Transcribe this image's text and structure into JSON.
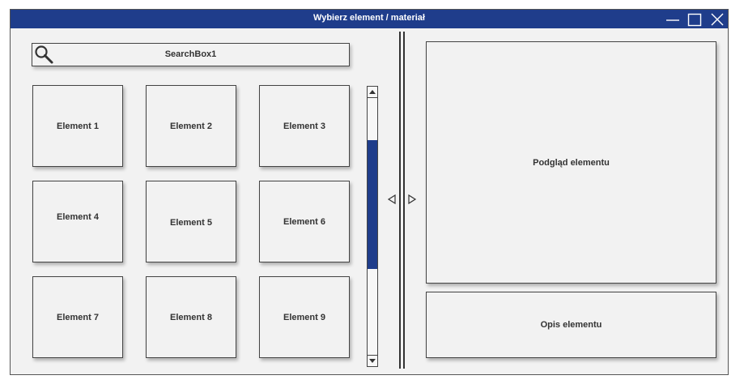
{
  "window": {
    "title": "Wybierz element / materiał"
  },
  "search": {
    "value": "SearchBox1"
  },
  "grid": {
    "items": [
      {
        "label": "Element 1"
      },
      {
        "label": "Element 2"
      },
      {
        "label": "Element 3"
      },
      {
        "label": "Element 4"
      },
      {
        "label": "Element 5"
      },
      {
        "label": "Element 6"
      },
      {
        "label": "Element 7"
      },
      {
        "label": "Element 8"
      },
      {
        "label": "Element 9"
      }
    ]
  },
  "scrollbar": {
    "position": 0.33,
    "visible_fraction": 0.5
  },
  "preview": {
    "label": "Podgląd elementu"
  },
  "description": {
    "label": "Opis elementu"
  },
  "icons": {
    "search": "search-icon",
    "minimize": "minimize-icon",
    "maximize": "maximize-icon",
    "close": "close-icon",
    "collapse": "triangle-left-icon",
    "expand": "triangle-right-icon"
  },
  "colors": {
    "accent": "#1f3d8b",
    "panel": "#f2f2f2",
    "border": "#444444"
  }
}
